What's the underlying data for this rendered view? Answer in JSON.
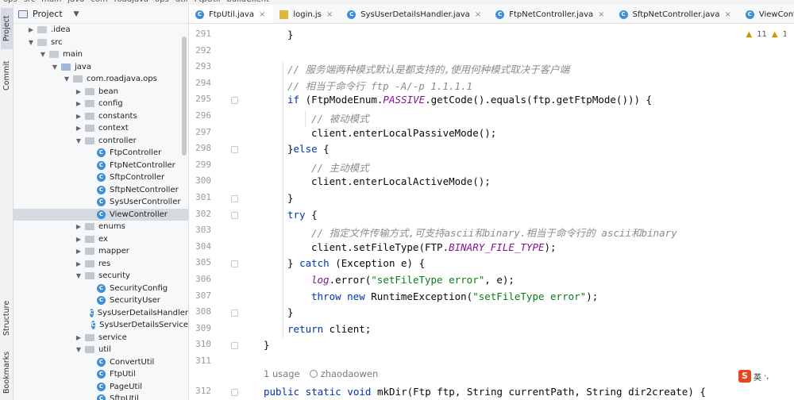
{
  "breadcrumb": [
    "ops",
    "src",
    "main",
    "java",
    "com",
    "roadjava",
    "ops",
    "util",
    "FtpUtil",
    "buildClient"
  ],
  "toolstrip": {
    "project_label": "Project",
    "commit_label": "Commit",
    "structure_label": "Structure",
    "bookmarks_label": "Bookmarks"
  },
  "project_panel": {
    "title": "Project",
    "tree": [
      {
        "label": ".idea",
        "depth": 1,
        "kind": "folder",
        "expanded": false
      },
      {
        "label": "src",
        "depth": 1,
        "kind": "folder",
        "expanded": true
      },
      {
        "label": "main",
        "depth": 2,
        "kind": "folder",
        "expanded": true
      },
      {
        "label": "java",
        "depth": 3,
        "kind": "src",
        "expanded": true
      },
      {
        "label": "com.roadjava.ops",
        "depth": 4,
        "kind": "pkg",
        "expanded": true
      },
      {
        "label": "bean",
        "depth": 5,
        "kind": "pkg",
        "expanded": false
      },
      {
        "label": "config",
        "depth": 5,
        "kind": "pkg",
        "expanded": false
      },
      {
        "label": "constants",
        "depth": 5,
        "kind": "pkg",
        "expanded": false
      },
      {
        "label": "context",
        "depth": 5,
        "kind": "pkg",
        "expanded": false
      },
      {
        "label": "controller",
        "depth": 5,
        "kind": "pkg",
        "expanded": true
      },
      {
        "label": "FtpController",
        "depth": 6,
        "kind": "class"
      },
      {
        "label": "FtpNetController",
        "depth": 6,
        "kind": "class"
      },
      {
        "label": "SftpController",
        "depth": 6,
        "kind": "class"
      },
      {
        "label": "SftpNetController",
        "depth": 6,
        "kind": "class"
      },
      {
        "label": "SysUserController",
        "depth": 6,
        "kind": "class"
      },
      {
        "label": "ViewController",
        "depth": 6,
        "kind": "class",
        "selected": true
      },
      {
        "label": "enums",
        "depth": 5,
        "kind": "pkg",
        "expanded": false
      },
      {
        "label": "ex",
        "depth": 5,
        "kind": "pkg",
        "expanded": false
      },
      {
        "label": "mapper",
        "depth": 5,
        "kind": "pkg",
        "expanded": false
      },
      {
        "label": "res",
        "depth": 5,
        "kind": "pkg",
        "expanded": false
      },
      {
        "label": "security",
        "depth": 5,
        "kind": "pkg",
        "expanded": true
      },
      {
        "label": "SecurityConfig",
        "depth": 6,
        "kind": "class"
      },
      {
        "label": "SecurityUser",
        "depth": 6,
        "kind": "class"
      },
      {
        "label": "SysUserDetailsHandler",
        "depth": 6,
        "kind": "class"
      },
      {
        "label": "SysUserDetailsService",
        "depth": 6,
        "kind": "class"
      },
      {
        "label": "service",
        "depth": 5,
        "kind": "pkg",
        "expanded": false
      },
      {
        "label": "util",
        "depth": 5,
        "kind": "pkg",
        "expanded": true
      },
      {
        "label": "ConvertUtil",
        "depth": 6,
        "kind": "class"
      },
      {
        "label": "FtpUtil",
        "depth": 6,
        "kind": "class"
      },
      {
        "label": "PageUtil",
        "depth": 6,
        "kind": "class"
      },
      {
        "label": "SftpUtil",
        "depth": 6,
        "kind": "class"
      }
    ]
  },
  "tabs": [
    {
      "label": "FtpUtil.java",
      "icon": "class-icon",
      "active": true
    },
    {
      "label": "login.js",
      "icon": "js-file-icon",
      "active": false
    },
    {
      "label": "SysUserDetailsHandler.java",
      "icon": "class-icon",
      "active": false
    },
    {
      "label": "FtpNetController.java",
      "icon": "class-icon",
      "active": false
    },
    {
      "label": "SftpNetController.java",
      "icon": "class-icon",
      "active": false
    },
    {
      "label": "ViewController.java",
      "icon": "class-icon",
      "active": false
    }
  ],
  "inspections": {
    "warnings": "11",
    "weak": "1"
  },
  "editor": {
    "lines": [
      {
        "n": "291",
        "indent": 1,
        "tokens": [
          [
            "p",
            "}"
          ]
        ]
      },
      {
        "n": "292",
        "indent": 0,
        "tokens": []
      },
      {
        "n": "293",
        "indent": 1,
        "tokens": [
          [
            "cm",
            "// 服务端两种模式默认是都支持的,使用何种模式取决于客户端"
          ]
        ]
      },
      {
        "n": "294",
        "indent": 1,
        "tokens": [
          [
            "cm",
            "// 相当于命令行 ftp -A/-p 1.1.1.1"
          ]
        ]
      },
      {
        "n": "295",
        "indent": 1,
        "tokens": [
          [
            "kw",
            "if"
          ],
          [
            "p",
            " (FtpModeEnum."
          ],
          [
            "const",
            "PASSIVE"
          ],
          [
            "p",
            ".getCode().equals(ftp.getFtpMode())) {"
          ]
        ]
      },
      {
        "n": "296",
        "indent": 2,
        "tokens": [
          [
            "cm",
            "// 被动模式"
          ]
        ]
      },
      {
        "n": "297",
        "indent": 2,
        "tokens": [
          [
            "p",
            "client.enterLocalPassiveMode();"
          ]
        ]
      },
      {
        "n": "298",
        "indent": 1,
        "tokens": [
          [
            "p",
            "}"
          ],
          [
            "kw",
            "else"
          ],
          [
            "p",
            " {"
          ]
        ]
      },
      {
        "n": "299",
        "indent": 2,
        "tokens": [
          [
            "cm",
            "// 主动模式"
          ]
        ]
      },
      {
        "n": "300",
        "indent": 2,
        "tokens": [
          [
            "p",
            "client.enterLocalActiveMode();"
          ]
        ]
      },
      {
        "n": "301",
        "indent": 1,
        "tokens": [
          [
            "p",
            "}"
          ]
        ]
      },
      {
        "n": "302",
        "indent": 1,
        "tokens": [
          [
            "kw",
            "try"
          ],
          [
            "p",
            " {"
          ]
        ]
      },
      {
        "n": "303",
        "indent": 2,
        "tokens": [
          [
            "cm",
            "// 指定文件传输方式,可支持ascii和binary.相当于命令行的 ascii和binary"
          ]
        ]
      },
      {
        "n": "304",
        "indent": 2,
        "tokens": [
          [
            "p",
            "client.setFileType(FTP."
          ],
          [
            "const",
            "BINARY_FILE_TYPE"
          ],
          [
            "p",
            ");"
          ]
        ]
      },
      {
        "n": "305",
        "indent": 1,
        "tokens": [
          [
            "p",
            "} "
          ],
          [
            "kw",
            "catch"
          ],
          [
            "p",
            " (Exception e) {"
          ]
        ]
      },
      {
        "n": "306",
        "indent": 2,
        "tokens": [
          [
            "fld",
            "log"
          ],
          [
            "p",
            ".error("
          ],
          [
            "str",
            "\"setFileType error\""
          ],
          [
            "p",
            ", e);"
          ]
        ]
      },
      {
        "n": "307",
        "indent": 2,
        "tokens": [
          [
            "kw",
            "throw new"
          ],
          [
            "p",
            " RuntimeException("
          ],
          [
            "str",
            "\"setFileType error\""
          ],
          [
            "p",
            ");"
          ]
        ]
      },
      {
        "n": "308",
        "indent": 1,
        "tokens": [
          [
            "p",
            "}"
          ]
        ]
      },
      {
        "n": "309",
        "indent": 1,
        "tokens": [
          [
            "kw",
            "return"
          ],
          [
            "p",
            " client;"
          ]
        ]
      },
      {
        "n": "310",
        "indent": 0,
        "tokens": [
          [
            "p",
            "}"
          ]
        ]
      },
      {
        "n": "311",
        "indent": 0,
        "tokens": []
      }
    ],
    "usage_hint": {
      "count": "1 usage",
      "author": "zhaodaowen"
    },
    "last_line": {
      "n": "312",
      "tokens": [
        [
          "kw",
          "public static void"
        ],
        [
          "p",
          " mkDir(Ftp ftp, String currentPath, String dir2create) {"
        ]
      ]
    }
  },
  "ime": {
    "logo": "S",
    "mode": "英",
    "extra": "·,"
  }
}
